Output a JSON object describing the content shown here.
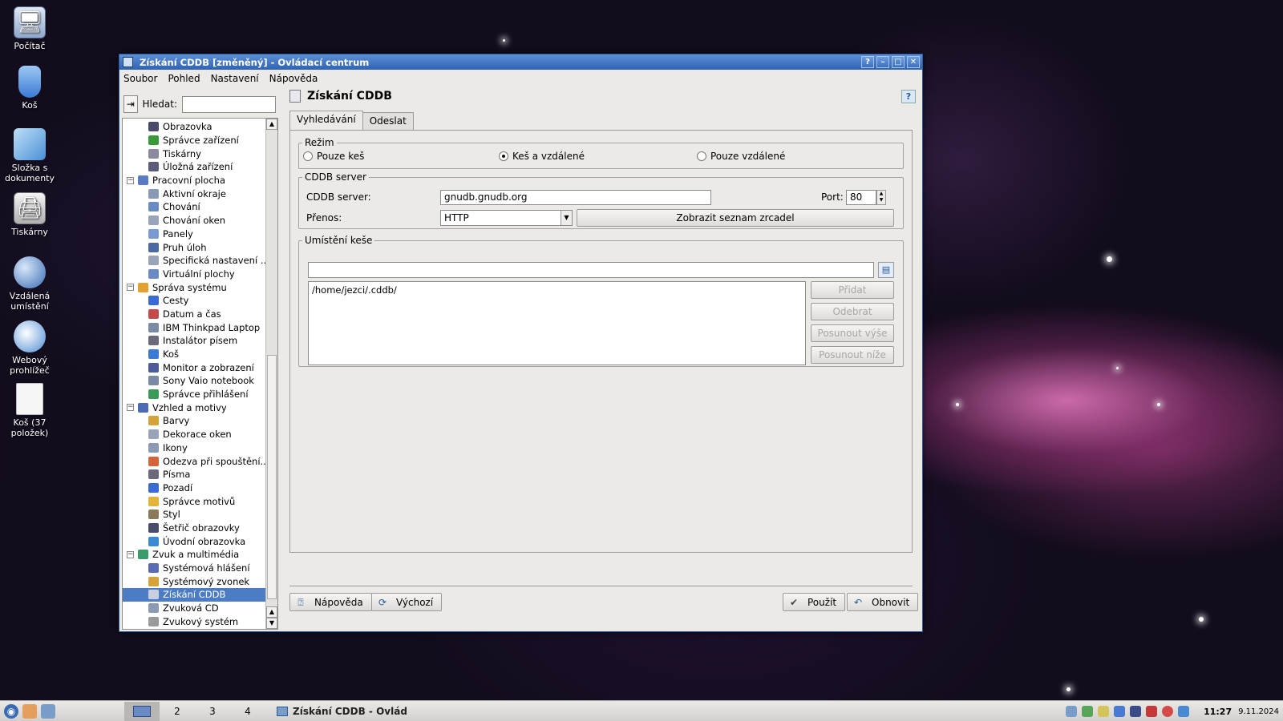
{
  "desktop": {
    "icons": [
      {
        "label": "Počítač",
        "icon": "computer-icon"
      },
      {
        "label": "Koš",
        "icon": "trash-icon"
      },
      {
        "label": "Složka s dokumenty",
        "icon": "documents-folder-icon"
      },
      {
        "label": "Tiskárny",
        "icon": "printer-icon"
      },
      {
        "label": "Vzdálená umístění",
        "icon": "network-globe-icon"
      },
      {
        "label": "Webový prohlížeč",
        "icon": "web-browser-icon"
      },
      {
        "label": "Koš (37 položek)",
        "icon": "trash-full-icon"
      }
    ]
  },
  "window": {
    "title": "Získání CDDB [změněný] - Ovládací centrum",
    "controls": [
      "?",
      "–",
      "□",
      "✕"
    ]
  },
  "menu": [
    "Soubor",
    "Pohled",
    "Nastavení",
    "Nápověda"
  ],
  "sidebar": {
    "search_label": "Hledat:",
    "search_value": "",
    "tree": [
      {
        "label": "Obrazovka",
        "type": "item",
        "color": "#4a4a6a"
      },
      {
        "label": "Správce zařízení",
        "type": "item",
        "color": "#3a9a3a"
      },
      {
        "label": "Tiskárny",
        "type": "item",
        "color": "#8a8aa0"
      },
      {
        "label": "Úložná zařízení",
        "type": "item",
        "color": "#5a5a7a"
      },
      {
        "label": "Pracovní plocha",
        "type": "cat",
        "color": "#5a7ac4"
      },
      {
        "label": "Aktivní okraje",
        "type": "item",
        "color": "#8a9ab4"
      },
      {
        "label": "Chování",
        "type": "item",
        "color": "#6a8ac4"
      },
      {
        "label": "Chování oken",
        "type": "item",
        "color": "#9aa4b8"
      },
      {
        "label": "Panely",
        "type": "item",
        "color": "#7a9ad4"
      },
      {
        "label": "Pruh úloh",
        "type": "item",
        "color": "#4a6aa4"
      },
      {
        "label": "Specifická nastavení ...",
        "type": "item",
        "color": "#9aa4b8"
      },
      {
        "label": "Virtuální plochy",
        "type": "item",
        "color": "#6a8ac4"
      },
      {
        "label": "Správa systému",
        "type": "cat",
        "color": "#e4a030"
      },
      {
        "label": "Cesty",
        "type": "item",
        "color": "#3a6ad4"
      },
      {
        "label": "Datum a čas",
        "type": "item",
        "color": "#c44a4a"
      },
      {
        "label": "IBM Thinkpad Laptop",
        "type": "item",
        "color": "#7a8aa4"
      },
      {
        "label": "Instalátor písem",
        "type": "item",
        "color": "#6a6a7a"
      },
      {
        "label": "Koš",
        "type": "item",
        "color": "#3a7ad4"
      },
      {
        "label": "Monitor a zobrazení",
        "type": "item",
        "color": "#4a5a9a"
      },
      {
        "label": "Sony Vaio notebook",
        "type": "item",
        "color": "#7a8aa4"
      },
      {
        "label": "Správce přihlášení",
        "type": "item",
        "color": "#3a9a5a"
      },
      {
        "label": "Vzhled a motivy",
        "type": "cat",
        "color": "#4a6ab4"
      },
      {
        "label": "Barvy",
        "type": "item",
        "color": "#d4a43a"
      },
      {
        "label": "Dekorace oken",
        "type": "item",
        "color": "#9aa4b8"
      },
      {
        "label": "Ikony",
        "type": "item",
        "color": "#8a9ab4"
      },
      {
        "label": "Odezva při spouštění...",
        "type": "item",
        "color": "#d4643a"
      },
      {
        "label": "Písma",
        "type": "item",
        "color": "#6a6a7a"
      },
      {
        "label": "Pozadí",
        "type": "item",
        "color": "#3a6ad4"
      },
      {
        "label": "Správce motivů",
        "type": "item",
        "color": "#e4b43a"
      },
      {
        "label": "Styl",
        "type": "item",
        "color": "#8a7a5a"
      },
      {
        "label": "Šetřič obrazovky",
        "type": "item",
        "color": "#4a4a6a"
      },
      {
        "label": "Úvodní obrazovka",
        "type": "item",
        "color": "#3a8ad4"
      },
      {
        "label": "Zvuk a multimédia",
        "type": "cat",
        "color": "#3a9a6a"
      },
      {
        "label": "Systémová hlášení",
        "type": "item",
        "color": "#5a6ab4"
      },
      {
        "label": "Systémový zvonek",
        "type": "item",
        "color": "#d4a43a"
      },
      {
        "label": "Získání CDDB",
        "type": "item",
        "color": "#c8d0e0",
        "selected": true
      },
      {
        "label": "Zvuková CD",
        "type": "item",
        "color": "#8a9ab4"
      },
      {
        "label": "Zvukový systém",
        "type": "item",
        "color": "#9a9a9a"
      }
    ]
  },
  "panel": {
    "title": "Získání CDDB",
    "tabs": [
      "Vyhledávání",
      "Odeslat"
    ],
    "mode_group": {
      "legend": "Režim",
      "options": [
        {
          "label": "Pouze keš",
          "checked": false
        },
        {
          "label": "Keš a vzdálené",
          "checked": true
        },
        {
          "label": "Pouze vzdálené",
          "checked": false
        }
      ]
    },
    "server_group": {
      "legend": "CDDB server",
      "server_label": "CDDB server:",
      "server_value": "gnudb.gnudb.org",
      "port_label": "Port:",
      "port_value": "80",
      "transfer_label": "Přenos:",
      "transfer_value": "HTTP",
      "mirrors_button": "Zobrazit seznam zrcadel"
    },
    "cache_group": {
      "legend": "Umístění keše",
      "path_value": "",
      "locations": [
        "/home/jezci/.cddb/"
      ],
      "buttons": [
        "Přidat",
        "Odebrat",
        "Posunout výše",
        "Posunout níže"
      ]
    },
    "footer": {
      "help": "Nápověda",
      "defaults": "Výchozí",
      "apply": "Použít",
      "reset": "Obnovit"
    }
  },
  "taskbar": {
    "desktops": [
      "1",
      "2",
      "3",
      "4"
    ],
    "active_task": "Získání CDDB - Ovlád",
    "clock": "11:27",
    "date": "9.11.2024"
  }
}
